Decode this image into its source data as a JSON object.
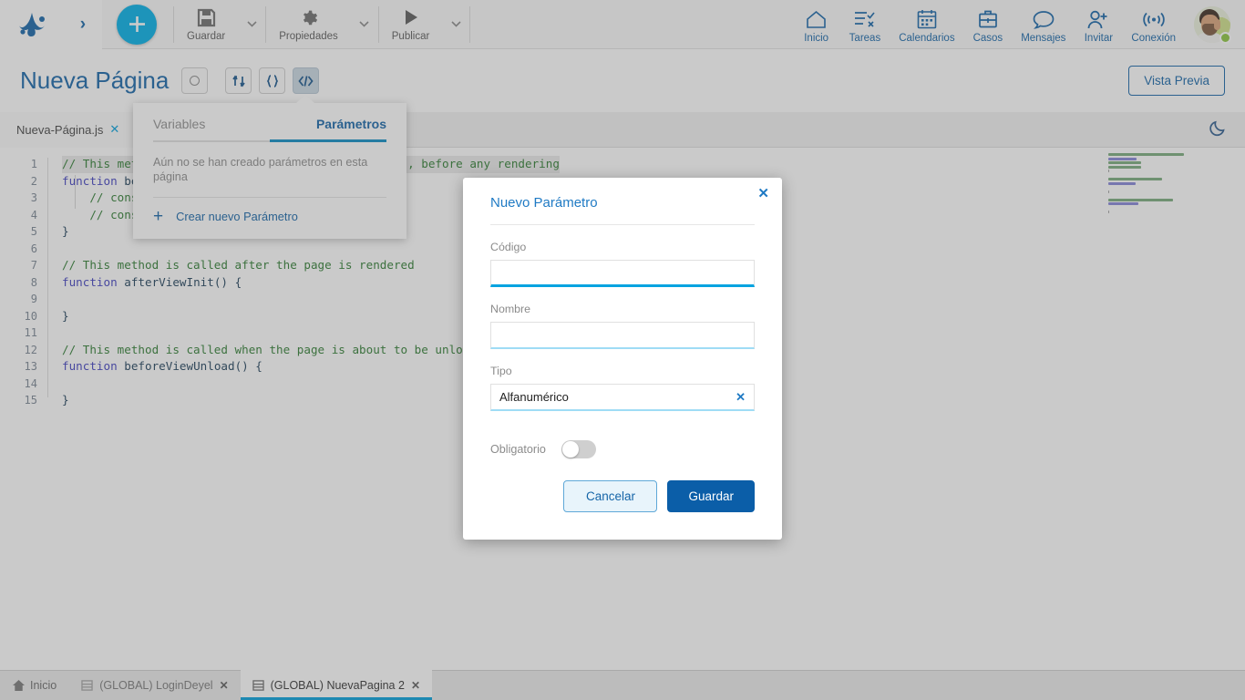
{
  "toolbar": {
    "add_button_label": "+",
    "items": [
      {
        "label": "Guardar",
        "icon": "save-icon",
        "has_caret": true
      },
      {
        "label": "Propiedades",
        "icon": "gear-icon",
        "has_caret": true
      },
      {
        "label": "Publicar",
        "icon": "play-icon",
        "has_caret": true
      }
    ],
    "nav": [
      {
        "label": "Inicio",
        "icon": "home-icon"
      },
      {
        "label": "Tareas",
        "icon": "tasks-icon"
      },
      {
        "label": "Calendarios",
        "icon": "calendar-icon"
      },
      {
        "label": "Casos",
        "icon": "briefcase-icon"
      },
      {
        "label": "Mensajes",
        "icon": "chat-bubble-icon"
      },
      {
        "label": "Invitar",
        "icon": "person-add-icon"
      },
      {
        "label": "Conexión",
        "icon": "broadcast-icon"
      }
    ],
    "avatar_status": "online"
  },
  "page_header": {
    "title": "Nueva Página",
    "buttons": [
      {
        "name": "status-circle-button",
        "glyph": "circle"
      },
      {
        "name": "flow-button",
        "glyph": "flow"
      },
      {
        "name": "braces-button",
        "glyph": "{}"
      },
      {
        "name": "code-button",
        "glyph": "</>",
        "active": true
      }
    ],
    "preview_label": "Vista Previa"
  },
  "editor": {
    "tab_label": "Nueva-Página.js",
    "tab_close": "✕",
    "theme_toggle_icon": "moon-icon",
    "line_numbers": [
      1,
      2,
      3,
      4,
      5,
      6,
      7,
      8,
      9,
      10,
      11,
      12,
      13,
      14,
      15
    ],
    "code_lines": [
      {
        "n": 1,
        "segments": [
          {
            "t": "// This method is called before the page is loaded, before any rendering",
            "c": "cm"
          }
        ]
      },
      {
        "n": 2,
        "segments": [
          {
            "t": "function ",
            "c": "kw"
          },
          {
            "t": "beforePageLoad() {",
            "c": "fn"
          }
        ]
      },
      {
        "n": 3,
        "segments": [
          {
            "t": "    // console.log(getValue());",
            "c": "cm"
          }
        ]
      },
      {
        "n": 4,
        "segments": [
          {
            "t": "    // console.log(setValue());",
            "c": "cm"
          }
        ]
      },
      {
        "n": 5,
        "segments": [
          {
            "t": "}",
            "c": "fn"
          }
        ]
      },
      {
        "n": 6,
        "segments": [
          {
            "t": "",
            "c": "fn"
          }
        ]
      },
      {
        "n": 7,
        "segments": [
          {
            "t": "// This method is called after the page is rendered",
            "c": "cm"
          }
        ]
      },
      {
        "n": 8,
        "segments": [
          {
            "t": "function ",
            "c": "kw"
          },
          {
            "t": "afterViewInit() {",
            "c": "fn"
          }
        ]
      },
      {
        "n": 9,
        "segments": [
          {
            "t": "",
            "c": "fn"
          }
        ]
      },
      {
        "n": 10,
        "segments": [
          {
            "t": "}",
            "c": "fn"
          }
        ]
      },
      {
        "n": 11,
        "segments": [
          {
            "t": "",
            "c": "fn"
          }
        ]
      },
      {
        "n": 12,
        "segments": [
          {
            "t": "// This method is called when the page is about to be unloaded",
            "c": "cm"
          }
        ]
      },
      {
        "n": 13,
        "segments": [
          {
            "t": "function ",
            "c": "kw"
          },
          {
            "t": "beforeViewUnload() {",
            "c": "fn"
          }
        ]
      },
      {
        "n": 14,
        "segments": [
          {
            "t": "",
            "c": "fn"
          }
        ]
      },
      {
        "n": 15,
        "segments": [
          {
            "t": "}",
            "c": "fn"
          }
        ]
      }
    ]
  },
  "popover": {
    "tabs": [
      {
        "label": "Variables",
        "active": false
      },
      {
        "label": "Parámetros",
        "active": true
      }
    ],
    "empty_message": "Aún no se han creado parámetros en esta página",
    "create_label": "Crear nuevo Parámetro",
    "create_icon": "plus-icon"
  },
  "modal": {
    "title": "Nuevo Parámetro",
    "close_icon": "✕",
    "fields": [
      {
        "label": "Código",
        "value": "",
        "placeholder": "",
        "focused": true
      },
      {
        "label": "Nombre",
        "value": "",
        "placeholder": "",
        "focused": false
      }
    ],
    "type_field": {
      "label": "Tipo",
      "value": "Alfanumérico",
      "clear_icon": "✕"
    },
    "required_field": {
      "label": "Obligatorio",
      "enabled": false
    },
    "cancel_label": "Cancelar",
    "save_label": "Guardar"
  },
  "taskbar": {
    "home_label": "Inicio",
    "tabs": [
      {
        "label": "(GLOBAL) LoginDeyel",
        "active": false,
        "close": "✕"
      },
      {
        "label": "(GLOBAL) NuevaPagina 2",
        "active": true,
        "close": "✕"
      }
    ]
  },
  "colors": {
    "accent_blue": "#1565a8",
    "cyan": "#00b0e8",
    "save_blue": "#0b5ea8",
    "comment_green": "#2e7d32",
    "keyword_purple": "#4040c0"
  }
}
